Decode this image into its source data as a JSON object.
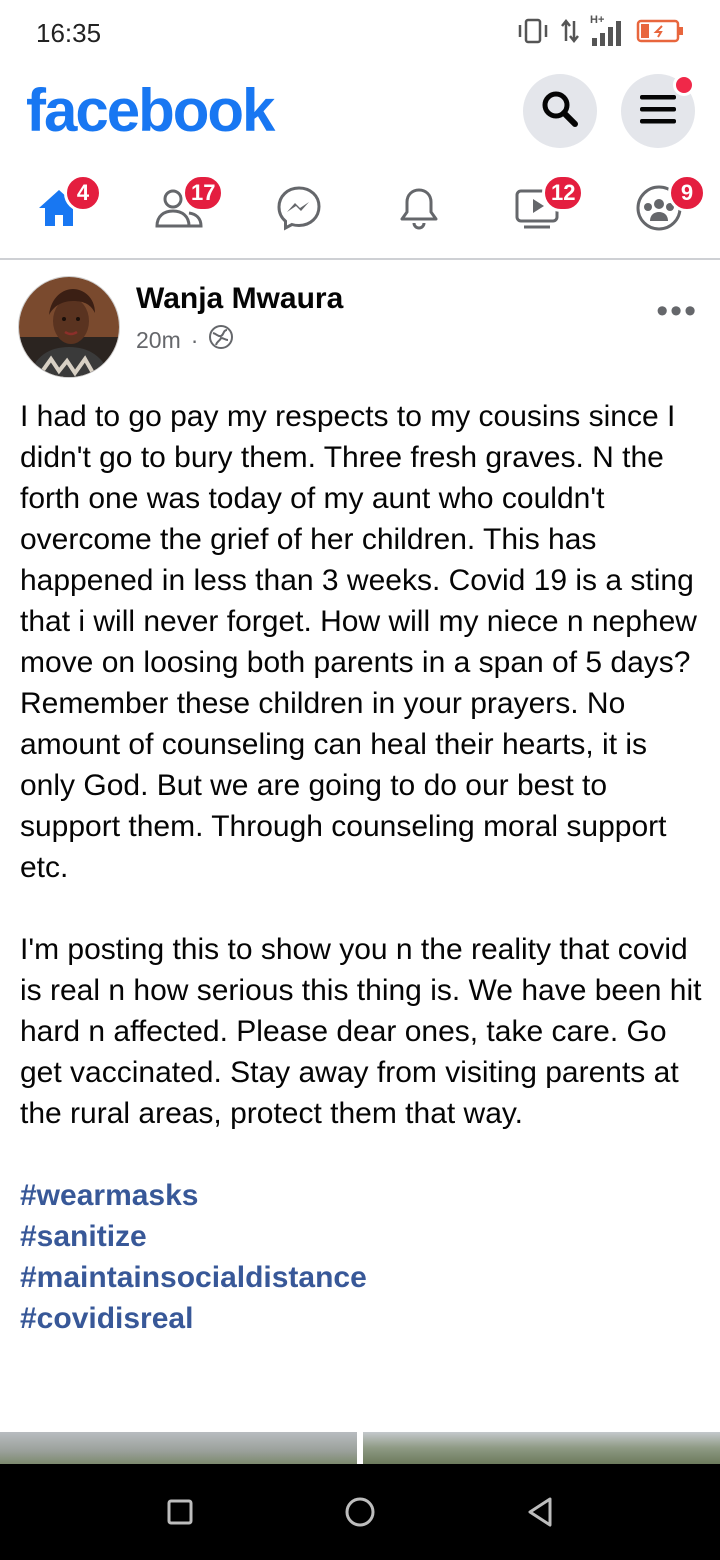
{
  "status_bar": {
    "time": "16:35",
    "network_label": "H+"
  },
  "header": {
    "logo": "facebook",
    "search_icon": "search-icon",
    "menu_icon": "hamburger-menu-icon",
    "brand_color": "#1877f2"
  },
  "nav": {
    "items": [
      {
        "name": "home",
        "icon": "home-icon",
        "badge": "4",
        "active": true
      },
      {
        "name": "friends",
        "icon": "friends-icon",
        "badge": "17"
      },
      {
        "name": "messenger",
        "icon": "messenger-icon",
        "badge": ""
      },
      {
        "name": "notifications",
        "icon": "bell-icon",
        "badge": ""
      },
      {
        "name": "watch",
        "icon": "video-icon",
        "badge": "12"
      },
      {
        "name": "groups",
        "icon": "groups-icon",
        "badge": "9"
      }
    ],
    "badge_color": "#e41e3f"
  },
  "post": {
    "author": "Wanja Mwaura",
    "time": "20m",
    "separator": "·",
    "privacy_icon": "globe-icon",
    "more_label": "•••",
    "paragraph1": "I had to go pay my respects to my cousins since I didn't go to bury them. Three fresh graves. N the forth one was today of my aunt who couldn't overcome the grief of her children. This has happened in less than 3 weeks. Covid 19 is a sting that i will never forget. How will my niece n nephew move on loosing both parents in a span of 5 days? Remember these children in your prayers. No amount of counseling can heal their hearts, it is only God. But we are going to do our best to support them. Through counseling moral support etc.",
    "paragraph2": "I'm posting this to show you n the reality that covid is real n how serious this thing is. We have been hit hard n affected.  Please dear ones, take care. Go get vaccinated. Stay away from visiting parents at the rural areas, protect them that way.",
    "hashtags": [
      "#wearmasks",
      "#sanitize",
      "#maintainsocialdistance",
      "#covidisreal"
    ],
    "hashtag_color": "#385898"
  },
  "system_nav": {
    "recent": "square-icon",
    "home": "circle-icon",
    "back": "back-triangle-icon"
  }
}
